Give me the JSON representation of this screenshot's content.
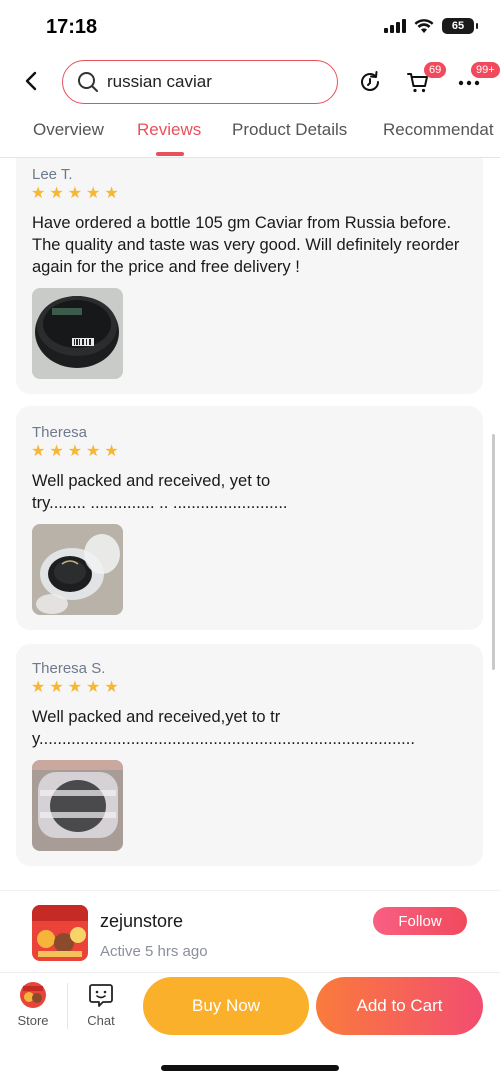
{
  "status": {
    "time": "17:18",
    "battery": "65"
  },
  "header": {
    "search_value": "russian caviar",
    "cart_badge": "69",
    "more_badge": "99+"
  },
  "tabs": [
    {
      "label": "Overview"
    },
    {
      "label": "Reviews",
      "active": true
    },
    {
      "label": "Product Details"
    },
    {
      "label": "Recommendat"
    }
  ],
  "reviews": [
    {
      "name": "Lee T.",
      "rating": 5,
      "text": "Have ordered a bottle 105 gm Caviar from Russia before. The  quality and taste was very good. Will definitely reorder again for the price and free delivery !",
      "image_icon": "caviar-tin-photo"
    },
    {
      "name": "Theresa",
      "rating": 5,
      "text": "Well packed and received, yet to try........ .............. .. .........................",
      "image_icon": "bubble-wrapped-tin-photo"
    },
    {
      "name": "Theresa S.",
      "rating": 5,
      "text": "Well packed and received,yet to try..................................................................................",
      "image_icon": "wrapped-package-photo"
    }
  ],
  "store": {
    "name": "zejunstore",
    "active": "Active 5 hrs ago",
    "follow_label": "Follow"
  },
  "bottom_bar": {
    "store_label": "Store",
    "chat_label": "Chat",
    "buy_now_label": "Buy Now",
    "add_cart_label": "Add to Cart"
  },
  "colors": {
    "accent": "#e8505b",
    "star": "#f7b733",
    "buy_now": "#fbb02c",
    "add_cart_start": "#fa7b3c",
    "add_cart_end": "#f24d70"
  }
}
